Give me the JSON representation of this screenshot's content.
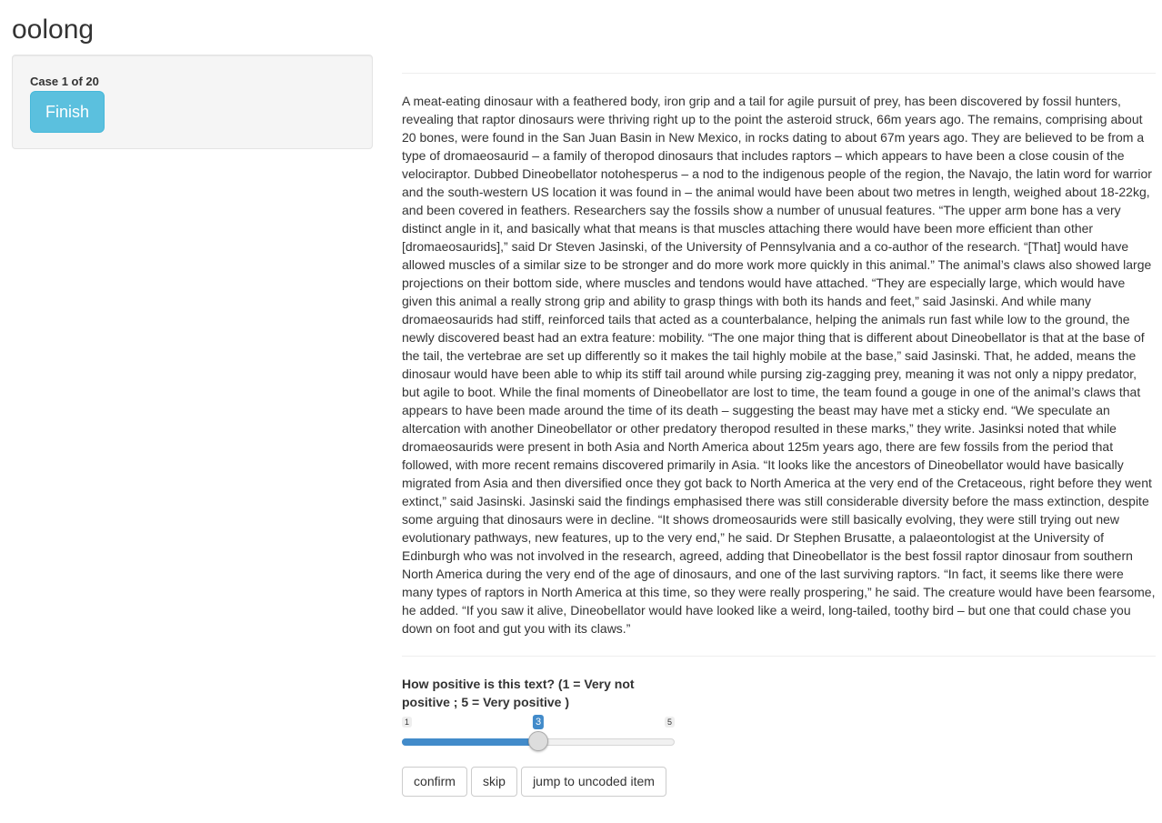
{
  "app": {
    "title": "oolong"
  },
  "sidebar": {
    "case_label": "Case 1 of 20",
    "finish_label": "Finish",
    "accent_color": "#5bc0de"
  },
  "main": {
    "text": "A meat-eating dinosaur with a feathered body, iron grip and a tail for agile pursuit of prey, has been discovered by fossil hunters, revealing that raptor dinosaurs were thriving right up to the point the asteroid struck, 66m years ago. The remains, comprising about 20 bones, were found in the San Juan Basin in New Mexico, in rocks dating to about 67m years ago. They are believed to be from a type of dromaeosaurid – a family of theropod dinosaurs that includes raptors – which appears to have been a close cousin of the velociraptor. Dubbed Dineobellator notohesperus – a nod to the indigenous people of the region, the Navajo, the latin word for warrior and the south-western US location it was found in – the animal would have been about two metres in length, weighed about 18-22kg, and been covered in feathers. Researchers say the fossils show a number of unusual features. “The upper arm bone has a very distinct angle in it, and basically what that means is that muscles attaching there would have been more efficient than other [dromaeosaurids],” said Dr Steven Jasinski, of the University of Pennsylvania and a co-author of the research. “[That] would have allowed muscles of a similar size to be stronger and do more work more quickly in this animal.” The animal’s claws also showed large projections on their bottom side, where muscles and tendons would have attached. “They are especially large, which would have given this animal a really strong grip and ability to grasp things with both its hands and feet,” said Jasinski. And while many dromaeosaurids had stiff, reinforced tails that acted as a counterbalance, helping the animals run fast while low to the ground, the newly discovered beast had an extra feature: mobility. “The one major thing that is different about Dineobellator is that at the base of the tail, the vertebrae are set up differently so it makes the tail highly mobile at the base,” said Jasinski. That, he added, means the dinosaur would have been able to whip its stiff tail around while pursing zig-zagging prey, meaning it was not only a nippy predator, but agile to boot. While the final moments of Dineobellator are lost to time, the team found a gouge in one of the animal’s claws that appears to have been made around the time of its death – suggesting the beast may have met a sticky end. “We speculate an altercation with another Dineobellator or other predatory theropod resulted in these marks,” they write. Jasinksi noted that while dromaeosaurids were present in both Asia and North America about 125m years ago, there are few fossils from the period that followed, with more recent remains discovered primarily in Asia. “It looks like the ancestors of Dineobellator would have basically migrated from Asia and then diversified once they got back to North America at the very end of the Cretaceous, right before they went extinct,” said Jasinski. Jasinski said the findings emphasised there was still considerable diversity before the mass extinction, despite some arguing that dinosaurs were in decline. “It shows dromeosaurids were still basically evolving, they were still trying out new evolutionary pathways, new features, up to the very end,” he said. Dr Stephen Brusatte, a palaeontologist at the University of Edinburgh who was not involved in the research, agreed, adding that Dineobellator is the best fossil raptor dinosaur from southern North America during the very end of the age of dinosaurs, and one of the last surviving raptors. “In fact, it seems like there were many types of raptors in North America at this time, so they were really prospering,” he said. The creature would have been fearsome, he added. “If you saw it alive, Dineobellator would have looked like a weird, long-tailed, toothy bird – but one that could chase you down on foot and gut you with its claws.”"
  },
  "question": {
    "label": "How positive is this text? (1 = Very not positive ; 5 = Very positive )"
  },
  "slider": {
    "min": 1,
    "max": 5,
    "value": 3,
    "min_label": "1",
    "max_label": "5",
    "value_label": "3",
    "fill_color": "#428bca"
  },
  "buttons": {
    "confirm": "confirm",
    "skip": "skip",
    "jump": "jump to uncoded item"
  }
}
